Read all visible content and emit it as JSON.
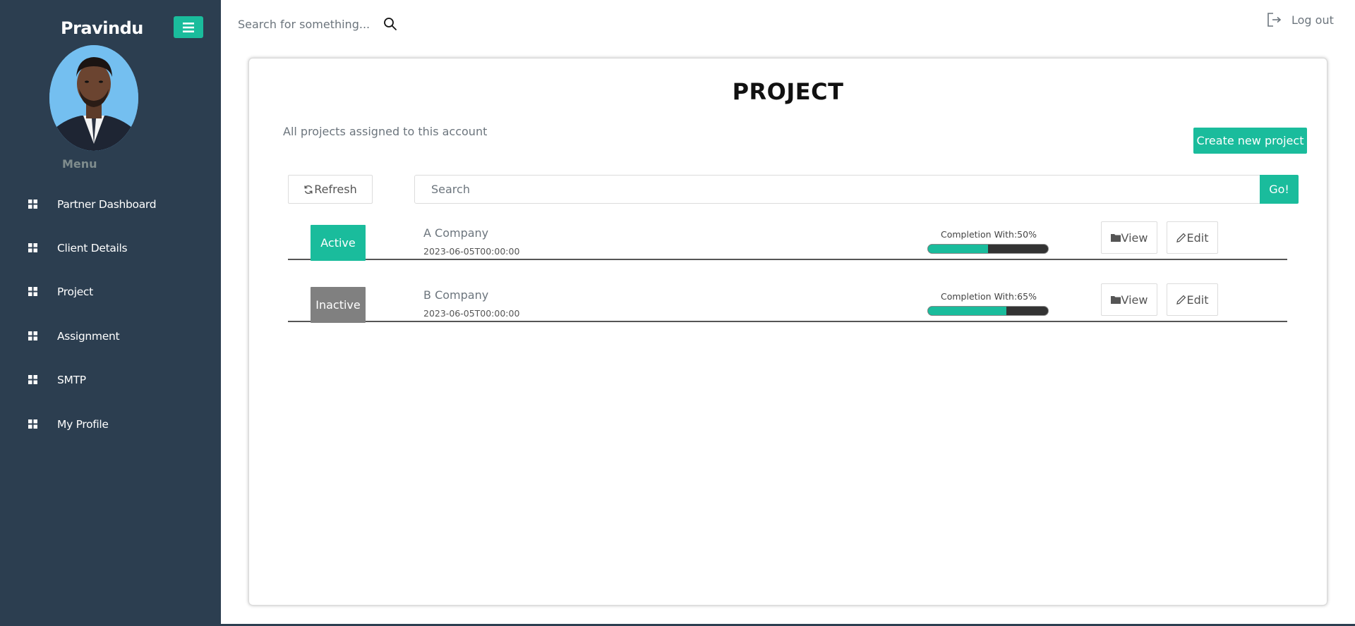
{
  "sidebar": {
    "brand": "Pravindu",
    "menu_caption": "Menu",
    "items": [
      {
        "label": "Partner Dashboard"
      },
      {
        "label": "Client Details"
      },
      {
        "label": "Project"
      },
      {
        "label": "Assignment"
      },
      {
        "label": "SMTP"
      },
      {
        "label": "My Profile"
      }
    ]
  },
  "topbar": {
    "search_placeholder": "Search for something...",
    "logout_label": "Log out"
  },
  "main": {
    "title": "PROJECT",
    "subtitle": "All projects assigned to this account",
    "create_label": "Create new project",
    "refresh_label": "Refresh",
    "search_placeholder": "Search",
    "go_label": "Go!",
    "projects": [
      {
        "status": "Active",
        "status_color": "#1abc9c",
        "company": "A Company",
        "date": "2023-06-05T00:00:00",
        "completion_label": "Completion With:50%",
        "completion_percent": 50,
        "view_label": "View",
        "edit_label": "Edit"
      },
      {
        "status": "Inactive",
        "status_color": "#808080",
        "company": "B Company",
        "date": "2023-06-05T00:00:00",
        "completion_label": "Completion With:65%",
        "completion_percent": 65,
        "view_label": "View",
        "edit_label": "Edit"
      }
    ]
  },
  "colors": {
    "sidebar_bg": "#2c3e50",
    "accent": "#1abc9c",
    "inactive": "#808080"
  },
  "icons": {
    "menu_toggle": "hamburger-icon",
    "nav_item": "grid-icon",
    "search": "search-icon",
    "logout": "logout-icon",
    "refresh": "refresh-icon",
    "view": "folder-icon",
    "edit": "pencil-icon"
  }
}
